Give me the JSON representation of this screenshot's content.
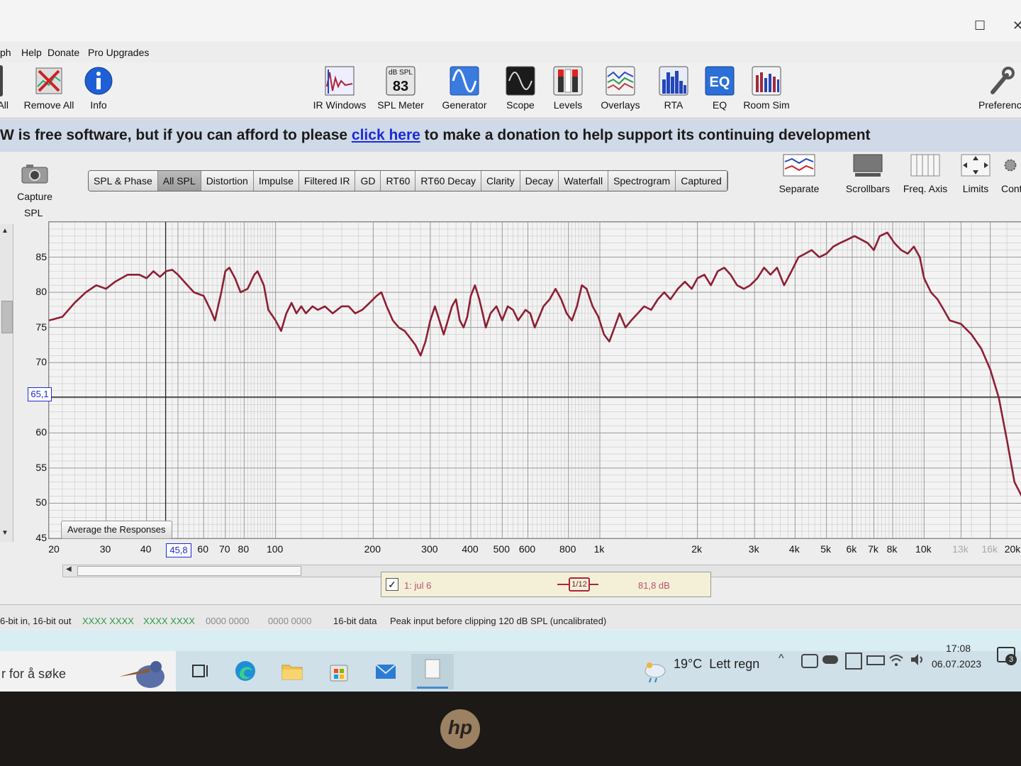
{
  "window": {
    "maximize_symbol": "☐",
    "close_symbol": "✕"
  },
  "menu": {
    "items": [
      "ph",
      "Help",
      "Donate",
      "Pro Upgrades"
    ]
  },
  "toolbar": {
    "left_buttons": [
      {
        "label": "All",
        "icon": "remove-all-icon"
      },
      {
        "label": "Remove All",
        "icon": "remove-all-icon"
      },
      {
        "label": "Info",
        "icon": "info-icon"
      }
    ],
    "buttons": [
      {
        "label": "IR Windows",
        "icon": "ir-windows-icon"
      },
      {
        "label": "SPL Meter",
        "icon": "spl-meter-icon",
        "icon_top": "dB SPL",
        "icon_value": "83"
      },
      {
        "label": "Generator",
        "icon": "generator-icon"
      },
      {
        "label": "Scope",
        "icon": "scope-icon"
      },
      {
        "label": "Levels",
        "icon": "levels-icon"
      },
      {
        "label": "Overlays",
        "icon": "overlays-icon"
      },
      {
        "label": "RTA",
        "icon": "rta-icon"
      },
      {
        "label": "EQ",
        "icon": "eq-icon"
      },
      {
        "label": "Room Sim",
        "icon": "room-sim-icon"
      }
    ],
    "preferences_label": "Preferenc"
  },
  "banner": {
    "before": "W is free software, but if you can afford to please ",
    "link": "click here",
    "after": " to make a donation to help support its continuing development"
  },
  "graph": {
    "capture_label": "Capture",
    "tabs": [
      "SPL & Phase",
      "All SPL",
      "Distortion",
      "Impulse",
      "Filtered IR",
      "GD",
      "RT60",
      "RT60 Decay",
      "Clarity",
      "Decay",
      "Waterfall",
      "Spectrogram",
      "Captured"
    ],
    "active_tab": "All SPL",
    "right_tools": [
      {
        "label": "Separate",
        "icon": "separate-icon"
      },
      {
        "label": "Scrollbars",
        "icon": "scrollbars-icon"
      },
      {
        "label": "Freq. Axis",
        "icon": "freq-axis-icon"
      },
      {
        "label": "Limits",
        "icon": "limits-icon"
      },
      {
        "label": "Cont",
        "icon": "controls-icon"
      }
    ],
    "average_label": "Average the Responses",
    "cursor_y": "65,1",
    "cursor_x": "45,8"
  },
  "chart_data": {
    "type": "line",
    "title": "",
    "xlabel": "",
    "ylabel": "SPL",
    "x_scale": "log",
    "xlim": [
      20,
      20000
    ],
    "ylim": [
      45,
      90
    ],
    "grid": true,
    "y_ticks": [
      "85",
      "80",
      "75",
      "70",
      "60",
      "55",
      "50",
      "45"
    ],
    "x_ticks": [
      {
        "label": "20",
        "value": 20
      },
      {
        "label": "30",
        "value": 30
      },
      {
        "label": "40",
        "value": 40
      },
      {
        "label": "0",
        "value": 50
      },
      {
        "label": "60",
        "value": 60
      },
      {
        "label": "70",
        "value": 70
      },
      {
        "label": "80",
        "value": 80
      },
      {
        "label": "100",
        "value": 100
      },
      {
        "label": "200",
        "value": 200
      },
      {
        "label": "300",
        "value": 300
      },
      {
        "label": "400",
        "value": 400
      },
      {
        "label": "500",
        "value": 500
      },
      {
        "label": "600",
        "value": 600
      },
      {
        "label": "800",
        "value": 800
      },
      {
        "label": "1k",
        "value": 1000
      },
      {
        "label": "2k",
        "value": 2000
      },
      {
        "label": "3k",
        "value": 3000
      },
      {
        "label": "4k",
        "value": 4000
      },
      {
        "label": "5k",
        "value": 5000
      },
      {
        "label": "6k",
        "value": 6000
      },
      {
        "label": "7k",
        "value": 7000
      },
      {
        "label": "8k",
        "value": 8000
      },
      {
        "label": "10k",
        "value": 10000
      },
      {
        "label": "13k",
        "value": 13000,
        "faint": true
      },
      {
        "label": "16k",
        "value": 16000,
        "faint": true
      },
      {
        "label": "20k",
        "value": 20000
      }
    ],
    "cursor": {
      "x": 45.8,
      "y": 65.1
    },
    "series": [
      {
        "name": "1: jul 6",
        "color": "#8e1f33",
        "points": [
          [
            20,
            76
          ],
          [
            22,
            76.5
          ],
          [
            24,
            78.5
          ],
          [
            26,
            80
          ],
          [
            28,
            81
          ],
          [
            30,
            80.5
          ],
          [
            32,
            81.5
          ],
          [
            35,
            82.5
          ],
          [
            38,
            82.5
          ],
          [
            40,
            82
          ],
          [
            42,
            83
          ],
          [
            44,
            82.2
          ],
          [
            46,
            83
          ],
          [
            48,
            83.2
          ],
          [
            50,
            82.5
          ],
          [
            53,
            81.2
          ],
          [
            56,
            80
          ],
          [
            60,
            79.5
          ],
          [
            63,
            77.5
          ],
          [
            65,
            76
          ],
          [
            68,
            80
          ],
          [
            70,
            83
          ],
          [
            72,
            83.5
          ],
          [
            75,
            82
          ],
          [
            78,
            80
          ],
          [
            82,
            80.5
          ],
          [
            86,
            82.5
          ],
          [
            88,
            83
          ],
          [
            92,
            81
          ],
          [
            95,
            77.5
          ],
          [
            100,
            76
          ],
          [
            104,
            74.5
          ],
          [
            108,
            77
          ],
          [
            112,
            78.5
          ],
          [
            116,
            77
          ],
          [
            120,
            78
          ],
          [
            124,
            77
          ],
          [
            130,
            78
          ],
          [
            135,
            77.5
          ],
          [
            142,
            78
          ],
          [
            150,
            77
          ],
          [
            160,
            78
          ],
          [
            168,
            78
          ],
          [
            176,
            77
          ],
          [
            185,
            77.5
          ],
          [
            195,
            78.5
          ],
          [
            205,
            79.5
          ],
          [
            212,
            80
          ],
          [
            220,
            78
          ],
          [
            230,
            76
          ],
          [
            240,
            75
          ],
          [
            250,
            74.5
          ],
          [
            260,
            73.5
          ],
          [
            270,
            72.5
          ],
          [
            280,
            71
          ],
          [
            290,
            73
          ],
          [
            300,
            76
          ],
          [
            310,
            78
          ],
          [
            320,
            76
          ],
          [
            330,
            74
          ],
          [
            340,
            76
          ],
          [
            350,
            78
          ],
          [
            360,
            79
          ],
          [
            370,
            76
          ],
          [
            380,
            75
          ],
          [
            390,
            76.5
          ],
          [
            400,
            79.5
          ],
          [
            412,
            81
          ],
          [
            425,
            79
          ],
          [
            435,
            77
          ],
          [
            445,
            75
          ],
          [
            460,
            77
          ],
          [
            480,
            78
          ],
          [
            500,
            76
          ],
          [
            520,
            78
          ],
          [
            540,
            77.5
          ],
          [
            560,
            76
          ],
          [
            590,
            77.5
          ],
          [
            610,
            77
          ],
          [
            630,
            75
          ],
          [
            650,
            76.5
          ],
          [
            670,
            78
          ],
          [
            700,
            79
          ],
          [
            730,
            80.5
          ],
          [
            760,
            79
          ],
          [
            790,
            77
          ],
          [
            820,
            76
          ],
          [
            850,
            78
          ],
          [
            880,
            81
          ],
          [
            910,
            80.5
          ],
          [
            950,
            78
          ],
          [
            990,
            76.5
          ],
          [
            1030,
            74
          ],
          [
            1070,
            73
          ],
          [
            1110,
            75
          ],
          [
            1150,
            77
          ],
          [
            1200,
            75
          ],
          [
            1250,
            76
          ],
          [
            1310,
            77
          ],
          [
            1370,
            78
          ],
          [
            1440,
            77.5
          ],
          [
            1510,
            79
          ],
          [
            1580,
            80
          ],
          [
            1650,
            79
          ],
          [
            1740,
            80.5
          ],
          [
            1830,
            81.5
          ],
          [
            1920,
            80.5
          ],
          [
            2000,
            82
          ],
          [
            2100,
            82.5
          ],
          [
            2200,
            81
          ],
          [
            2310,
            83
          ],
          [
            2420,
            83.5
          ],
          [
            2530,
            82.5
          ],
          [
            2650,
            81
          ],
          [
            2780,
            80.5
          ],
          [
            2910,
            81
          ],
          [
            3060,
            82
          ],
          [
            3210,
            83.5
          ],
          [
            3360,
            82.5
          ],
          [
            3520,
            83.5
          ],
          [
            3700,
            81
          ],
          [
            3900,
            83
          ],
          [
            4100,
            85
          ],
          [
            4300,
            85.5
          ],
          [
            4500,
            86
          ],
          [
            4750,
            85
          ],
          [
            5000,
            85.5
          ],
          [
            5250,
            86.5
          ],
          [
            5500,
            87
          ],
          [
            5800,
            87.5
          ],
          [
            6100,
            88
          ],
          [
            6400,
            87.5
          ],
          [
            6700,
            87
          ],
          [
            7000,
            86
          ],
          [
            7300,
            88
          ],
          [
            7700,
            88.5
          ],
          [
            8100,
            87
          ],
          [
            8500,
            86
          ],
          [
            8900,
            85.5
          ],
          [
            9300,
            86.5
          ],
          [
            9700,
            85
          ],
          [
            10000,
            82
          ],
          [
            10500,
            80
          ],
          [
            11000,
            79
          ],
          [
            11500,
            77.5
          ],
          [
            12000,
            76
          ],
          [
            13000,
            75.5
          ],
          [
            14000,
            74
          ],
          [
            15000,
            72
          ],
          [
            16000,
            69
          ],
          [
            17000,
            65
          ],
          [
            18000,
            59
          ],
          [
            19000,
            53
          ],
          [
            20000,
            51
          ]
        ]
      }
    ]
  },
  "legend": {
    "name": "1: jul 6",
    "smoothing": "1/12",
    "level": "81,8 dB"
  },
  "status": {
    "bits": "6-bit in, 16-bit out",
    "meter1": "XXXX XXXX",
    "meter2": "XXXX XXXX",
    "meter3": "0000 0000",
    "meter4": "0000 0000",
    "data": "16-bit data",
    "peak": "Peak input before clipping 120 dB SPL (uncalibrated)"
  },
  "taskbar": {
    "search_text": "r for å søke",
    "weather": "19°C  Lett regn",
    "time": "17:08",
    "date": "06.07.2023",
    "notifications": "3"
  },
  "laptop": {
    "logo": "hp"
  },
  "colors": {
    "curve": "#8e1f33",
    "banner_bg": "#cfd9e7",
    "link": "#1a2bd8",
    "grid_major": "#9a9a9a",
    "grid_minor": "#c8c8c8"
  }
}
